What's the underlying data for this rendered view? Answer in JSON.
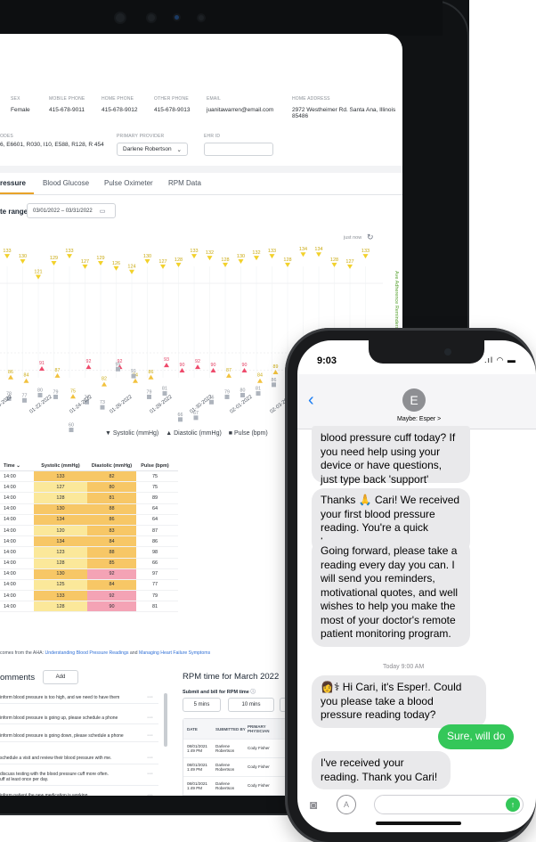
{
  "patient": {
    "sex_label": "SEX",
    "sex": "Female",
    "mobile_label": "MOBILE PHONE",
    "mobile": "415-678-9011",
    "home_label": "HOME PHONE",
    "home": "415-678-9012",
    "other_label": "OTHER PHONE",
    "other": "415-678-9013",
    "email_label": "EMAIL",
    "email": "juanitawarren@email.com",
    "address_label": "HOME ADDRESS",
    "address": "2972 Westheimer Rd. Santa Ana, Illinois 85486",
    "codes_label": "ODES",
    "codes": "6, E6601, R030, I10, E588, R128, R 454",
    "provider_label": "PRIMARY PROVIDER",
    "provider": "Darlene Robertson",
    "ehr_label": "EHR ID"
  },
  "tabs": [
    "ressure",
    "Blood Glucose",
    "Pulse Oximeter",
    "RPM Data"
  ],
  "date_range": {
    "label": "te range",
    "value": "03/01/2022 – 03/31/2022"
  },
  "refresh": {
    "label": "just now"
  },
  "chart_data": {
    "type": "scatter",
    "x_ticks": [
      "01-20-2022",
      "01-22-2022",
      "01-24-2022",
      "01-26-2022",
      "01-28-2022",
      "01-30-2022",
      "02-01-2022",
      "02-03-2022",
      "02-05-2022",
      "02-07-2022"
    ],
    "systolic": [
      133,
      130,
      121,
      129,
      133,
      127,
      129,
      126,
      124,
      130,
      127,
      128,
      133,
      132,
      128,
      130,
      132,
      133,
      128,
      134,
      134,
      128,
      127,
      133
    ],
    "diastolic": [
      86,
      84,
      91,
      87,
      75,
      92,
      82,
      92,
      84,
      86,
      93,
      90,
      92,
      90,
      87,
      90,
      84,
      89
    ],
    "pulse": [
      78,
      77,
      80,
      79,
      60,
      76,
      73,
      95,
      91,
      79,
      81,
      66,
      67,
      76,
      79,
      80,
      81,
      86,
      82,
      89,
      79,
      86
    ],
    "legend": [
      "Systolic (mmHg)",
      "Diastolic (mmHg)",
      "Pulse (bpm)"
    ],
    "side_label": "Ave Adherence",
    "side_label_2": "Reminders Triggered",
    "colors": {
      "systolic": "#f2d12b",
      "diastolic": "#ee4a6b",
      "pulse": "#aeb4bd"
    }
  },
  "table": {
    "headers": [
      "Time",
      "Systolic (mmHg)",
      "Diastolic (mmHg)",
      "Pulse (bpm)"
    ],
    "rows": [
      {
        "time": "14:00",
        "sys": "133",
        "dia": "82",
        "pulse": "75",
        "sc": "#f7c766",
        "dc": "#f7c766"
      },
      {
        "time": "14:00",
        "sys": "127",
        "dia": "80",
        "pulse": "75",
        "sc": "#fbe89a",
        "dc": "#f7c766"
      },
      {
        "time": "14:00",
        "sys": "128",
        "dia": "81",
        "pulse": "89",
        "sc": "#fbe89a",
        "dc": "#f7c766"
      },
      {
        "time": "14:00",
        "sys": "130",
        "dia": "88",
        "pulse": "64",
        "sc": "#f7c766",
        "dc": "#f7c766"
      },
      {
        "time": "14:00",
        "sys": "134",
        "dia": "86",
        "pulse": "64",
        "sc": "#f7c766",
        "dc": "#f7c766"
      },
      {
        "time": "14:00",
        "sys": "120",
        "dia": "83",
        "pulse": "87",
        "sc": "#fbe89a",
        "dc": "#f7c766"
      },
      {
        "time": "14:00",
        "sys": "134",
        "dia": "84",
        "pulse": "86",
        "sc": "#f7c766",
        "dc": "#f7c766"
      },
      {
        "time": "14:00",
        "sys": "123",
        "dia": "88",
        "pulse": "98",
        "sc": "#fbe89a",
        "dc": "#f7c766"
      },
      {
        "time": "14:00",
        "sys": "128",
        "dia": "85",
        "pulse": "66",
        "sc": "#fbe89a",
        "dc": "#f7c766"
      },
      {
        "time": "14:00",
        "sys": "130",
        "dia": "92",
        "pulse": "97",
        "sc": "#f7c766",
        "dc": "#f4a3b5"
      },
      {
        "time": "14:00",
        "sys": "125",
        "dia": "84",
        "pulse": "77",
        "sc": "#fbe89a",
        "dc": "#f7c766"
      },
      {
        "time": "14:00",
        "sys": "133",
        "dia": "92",
        "pulse": "79",
        "sc": "#f7c766",
        "dc": "#f4a3b5"
      },
      {
        "time": "14:00",
        "sys": "128",
        "dia": "90",
        "pulse": "81",
        "sc": "#fbe89a",
        "dc": "#f4a3b5"
      }
    ]
  },
  "footnote": {
    "text": "comes from the AHA: ",
    "link1": "Understanding Blood Pressure Readings",
    "and": " and ",
    "link2": "Managing Heart Failure Symptoms"
  },
  "comments": {
    "title": "omments",
    "add": "Add",
    "items": [
      "inform blood pressure is too high, and we need to have them",
      "inform blood pressure is going up, please schedule a phone",
      "inform blood pressure is going down, please schedule a phone",
      "schedule a visit and review their blood pressure with me.",
      "discuss testing with the blood pressure cuff more often.\nuff at least once per day.",
      "inform patient the new medication is working."
    ]
  },
  "rpm": {
    "title": "RPM time for March 2022",
    "subtitle": "Submit and bill for RPM time",
    "buttons": [
      "5 mins",
      "10 mins"
    ],
    "headers": [
      "DATE",
      "SUBMITTED BY",
      "PRIMARY PHYSICIAN"
    ],
    "rows": [
      {
        "date": "08/01/2021 1:49 PM",
        "by": "Darlene Robertson",
        "phys": "Cody Fisher"
      },
      {
        "date": "08/01/2021 1:49 PM",
        "by": "Darlene Robertson",
        "phys": "Cody Fisher"
      },
      {
        "date": "08/01/2021 1:49 PM",
        "by": "Darlene Robertson",
        "phys": "Cody Fisher"
      },
      {
        "date": "08/01/2021 1:49 PM",
        "by": "Darlene Robertson",
        "phys": "Cody Fisher"
      }
    ]
  },
  "phone": {
    "time": "9:03",
    "contact_initial": "E",
    "contact_name": "Maybe: Esper >",
    "messages": [
      "blood pressure cuff today? If you need help using your device or have questions, just type back 'support'",
      "Thanks 🙏 Cari! We received your first blood pressure reading. You're a quick learner.",
      "Going forward, please take a reading every day you can. I will send you reminders, motivational quotes, and well wishes to help you make the most of your doctor's remote patient monitoring program.",
      "👩⚕ Hi Cari, it's Esper!. Could you please take a blood pressure reading today?",
      "Sure, will do",
      "I've received your reading. Thank you Cari!"
    ],
    "today_label": "Today 9:00 AM"
  }
}
